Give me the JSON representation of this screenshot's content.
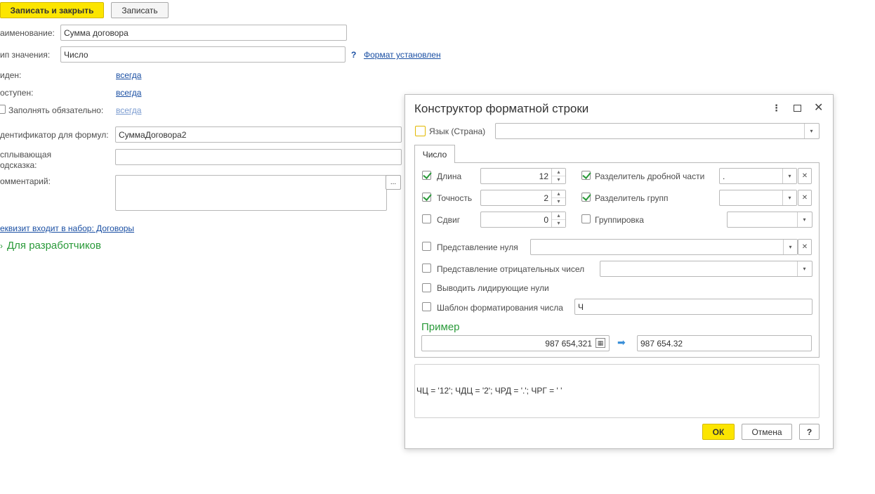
{
  "toolbar": {
    "save_close": "Записать и закрыть",
    "save": "Записать"
  },
  "form": {
    "name_label": "аименование:",
    "name_value": "Сумма договора",
    "type_label": "ип значения:",
    "type_value": "Число",
    "help_mark": "?",
    "format_link": "Формат установлен",
    "visible_label": "иден:",
    "visible_value": "всегда",
    "available_label": "оступен:",
    "available_value": "всегда",
    "required_label": "Заполнять обязательно:",
    "required_value": "всегда",
    "formula_id_label": "дентификатор для формул:",
    "formula_id_value": "СуммаДоговора2",
    "tooltip_label_1": "сплывающая",
    "tooltip_label_2": "одсказка:",
    "tooltip_value": "",
    "comment_label": "омментарий:",
    "comment_value": "",
    "comment_btn": "...",
    "set_link": "еквизит входит в набор: Договоры",
    "dev_section": "Для разработчиков"
  },
  "dialog": {
    "title": "Конструктор форматной строки",
    "lang_label": "Язык (Страна)",
    "lang_value": "",
    "tab": "Число",
    "length_label": "Длина",
    "length_value": "12",
    "precision_label": "Точность",
    "precision_value": "2",
    "shift_label": "Сдвиг",
    "shift_value": "0",
    "frac_sep_label": "Разделитель дробной части",
    "frac_sep_value": ".",
    "group_sep_label": "Разделитель групп",
    "group_sep_value": "",
    "grouping_label": "Группировка",
    "grouping_value": "",
    "zero_label": "Представление нуля",
    "zero_value": "",
    "negative_label": "Представление отрицательных чисел",
    "negative_value": "",
    "leading_zeros_label": "Выводить лидирующие нули",
    "template_label": "Шаблон форматирования числа",
    "template_value": "Ч",
    "example_title": "Пример",
    "example_input": "987 654,321",
    "example_output": "987 654.32",
    "format_string": "ЧЦ = '12'; ЧДЦ = '2'; ЧРД = '.'; ЧРГ = ' '",
    "ok": "ОК",
    "cancel": "Отмена",
    "help": "?"
  },
  "colors": {
    "accent_yellow": "#fce500",
    "link_blue": "#1a4fa3",
    "green": "#2a9a3a"
  }
}
